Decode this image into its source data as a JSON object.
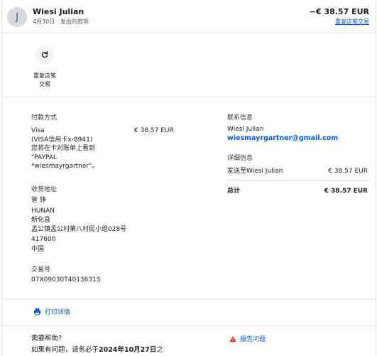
{
  "header": {
    "avatar_initial": "J",
    "name": "Wiesi Julian",
    "subtitle": "4月30日 · 发出的款项",
    "amount": "−€ 38.57 EUR",
    "repeat_link": "重复这笔交易"
  },
  "repeat_action": {
    "icon": "refresh-icon",
    "label_line1": "重复这笔",
    "label_line2": "交易"
  },
  "payment": {
    "title": "付款方式",
    "method": "Visa",
    "amount": "€ 38.57 EUR",
    "card": "(VISA信用卡x-8941)",
    "statement_line1": "您将在卡对账单上看到",
    "statement_line2": "\"PAYPAL",
    "statement_line3": "*wiesmayrgartner\"。"
  },
  "shipping": {
    "title": "收货地址",
    "name": "管 铮",
    "line1": "HUNAN",
    "line2": "新化县",
    "line3": "孟公镇孟公村第八村民小组028号",
    "postcode": "417600",
    "country": "中国"
  },
  "transaction": {
    "title": "交易号",
    "id": "07X09030T4013631S"
  },
  "contact": {
    "title": "联系信息",
    "name": "Wiesi Julian",
    "email": "wiesmayrgartner@gmail.com"
  },
  "details": {
    "title": "详细信息",
    "sent_to_label": "发送至Wiesi Julian",
    "sent_to_amount": "€ 38.57 EUR",
    "total_label": "总计",
    "total_amount": "€ 38.57 EUR"
  },
  "print": {
    "icon": "printer-icon",
    "label": "打印详情"
  },
  "help": {
    "title": "需要帮助?",
    "text_prefix": "如果有问题，请务必于",
    "date_bold": "2024年10月27日",
    "text_suffix": "之"
  },
  "report": {
    "icon": "warning-icon",
    "label": "报告问题"
  },
  "colors": {
    "link": "#0b57d0",
    "warning": "#d93025"
  }
}
